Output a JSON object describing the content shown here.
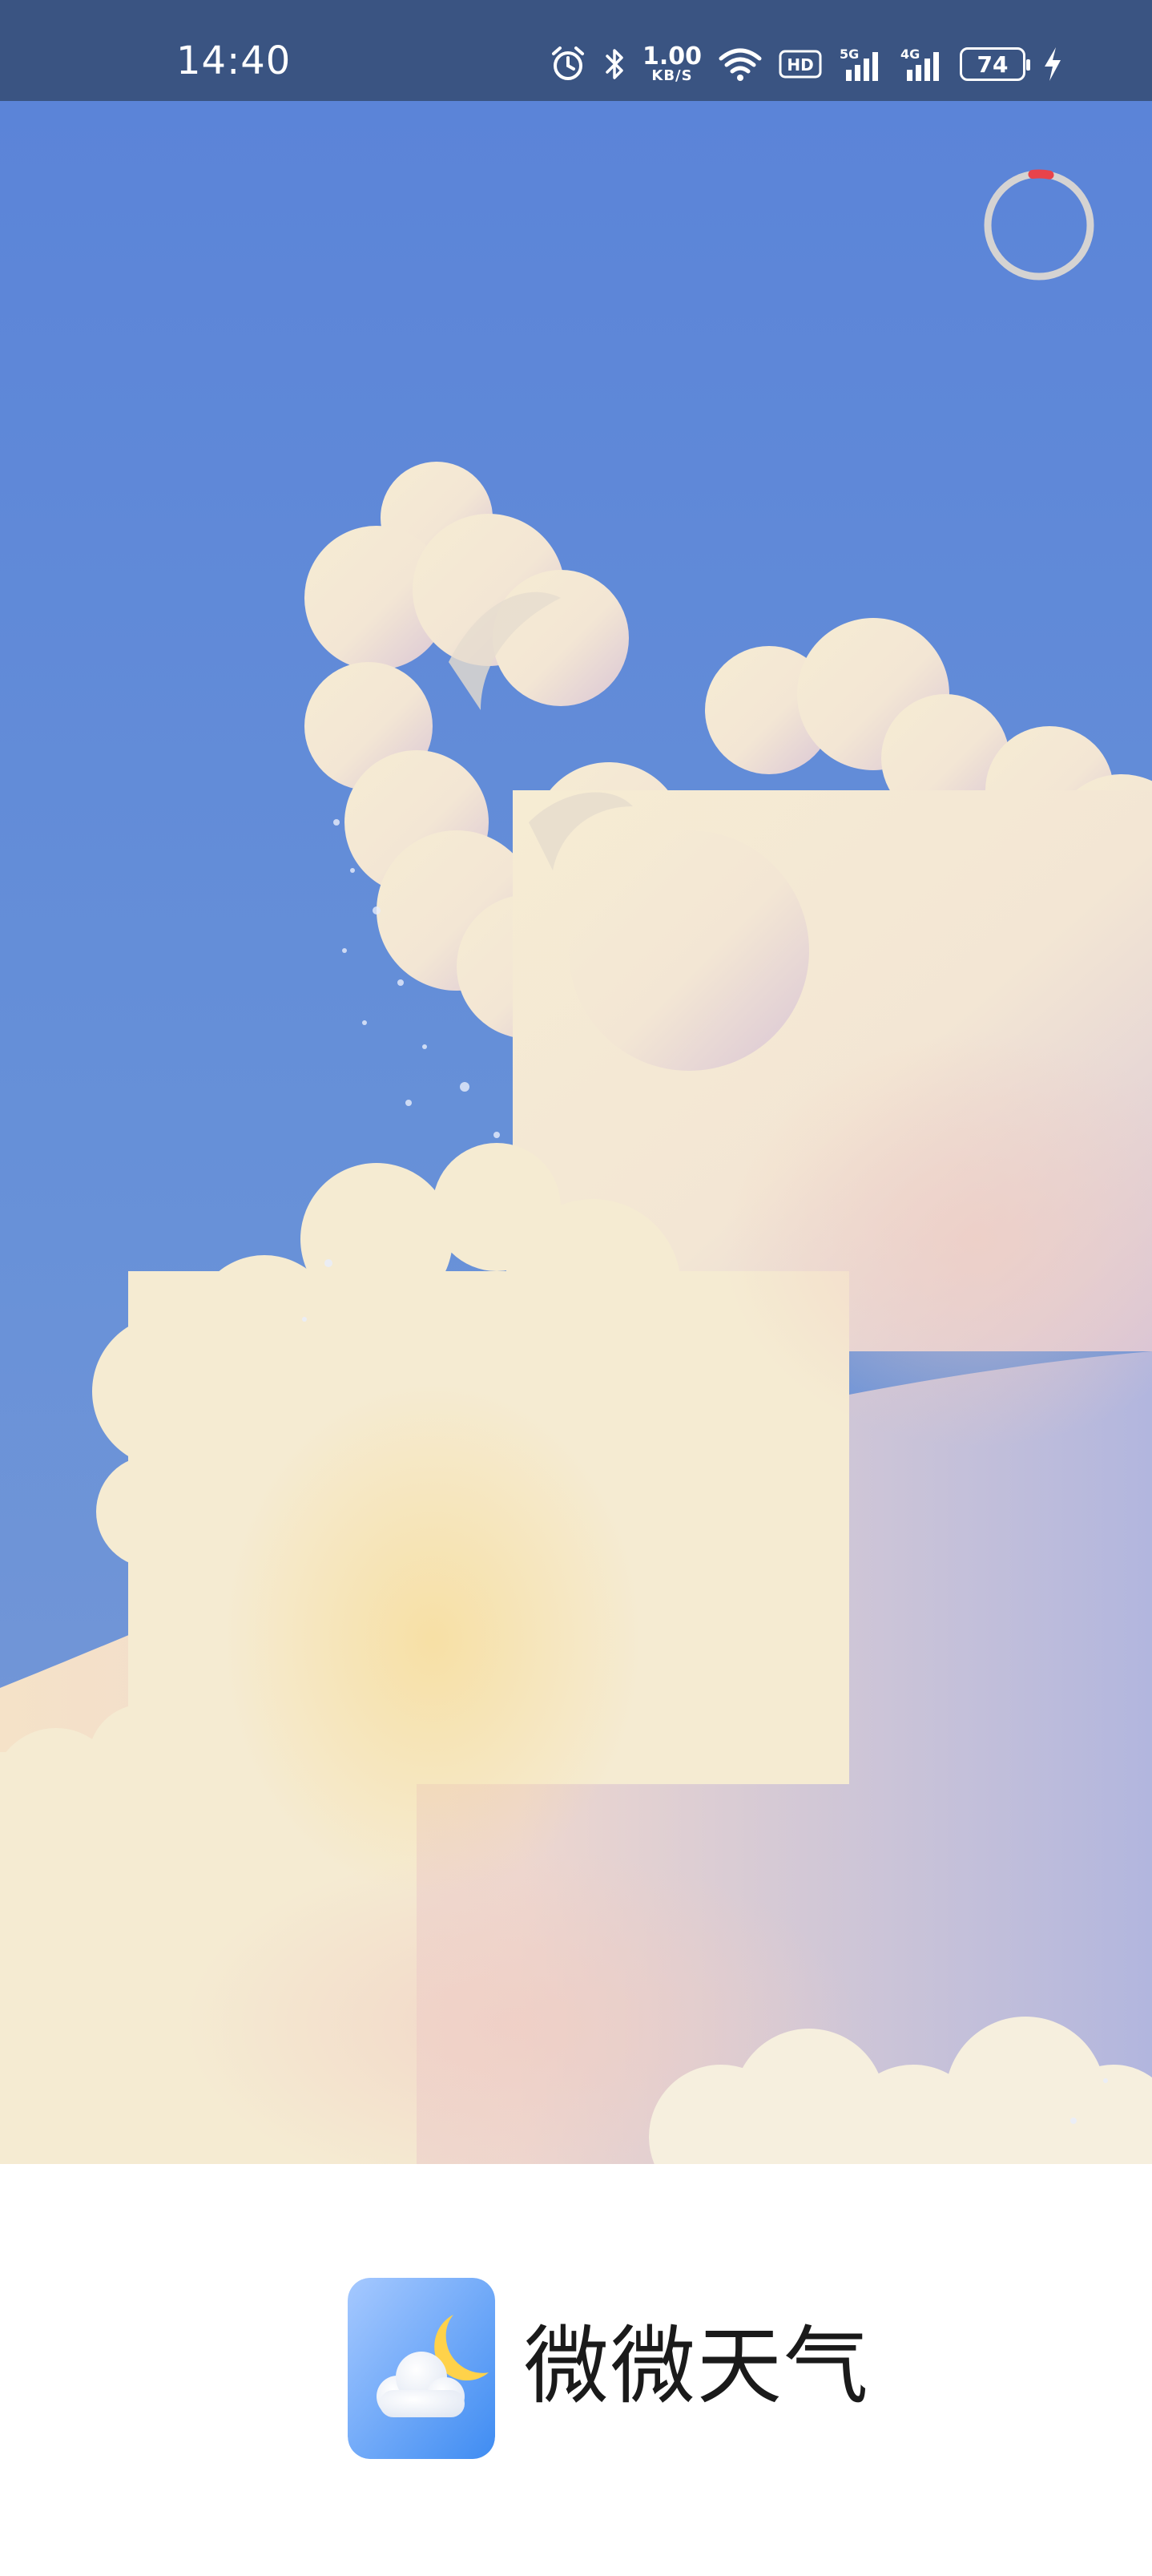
{
  "status_bar": {
    "time": "14:40",
    "net_speed_value": "1.00",
    "net_speed_unit": "KB/S",
    "battery_level": "74",
    "icons": [
      "alarm-icon",
      "bluetooth-icon",
      "wifi-icon",
      "hd-icon",
      "signal-5g-icon",
      "signal-4g-icon",
      "battery-icon",
      "charging-icon"
    ]
  },
  "splash": {
    "skip_countdown_progress": 0.03,
    "accent_color": "#e8434b"
  },
  "brand": {
    "app_name": "微微天气",
    "icon": "cloud-moon-icon"
  },
  "colors": {
    "status_bar_bg": "#3a5482",
    "sky_top": "#5b84d8",
    "cloud": "#f3ead6"
  }
}
